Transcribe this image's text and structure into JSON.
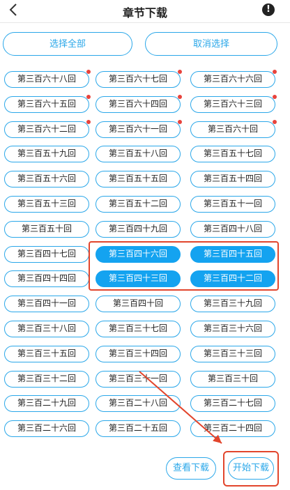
{
  "header": {
    "title": "章节下载",
    "info_symbol": "!"
  },
  "actions": {
    "select_all": "选择全部",
    "cancel_select": "取消选择"
  },
  "chapters": [
    {
      "label": "第三百六十八回",
      "dot": true,
      "selected": false
    },
    {
      "label": "第三百六十七回",
      "dot": true,
      "selected": false
    },
    {
      "label": "第三百六十六回",
      "dot": true,
      "selected": false
    },
    {
      "label": "第三百六十五回",
      "dot": true,
      "selected": false
    },
    {
      "label": "第三百六十四回",
      "dot": true,
      "selected": false
    },
    {
      "label": "第三百六十三回",
      "dot": true,
      "selected": false
    },
    {
      "label": "第三百六十二回",
      "dot": true,
      "selected": false
    },
    {
      "label": "第三百六十一回",
      "dot": true,
      "selected": false
    },
    {
      "label": "第三百六十回",
      "dot": true,
      "selected": false
    },
    {
      "label": "第三百五十九回",
      "dot": false,
      "selected": false
    },
    {
      "label": "第三百五十八回",
      "dot": false,
      "selected": false
    },
    {
      "label": "第三百五十七回",
      "dot": false,
      "selected": false
    },
    {
      "label": "第三百五十六回",
      "dot": false,
      "selected": false
    },
    {
      "label": "第三百五十五回",
      "dot": false,
      "selected": false
    },
    {
      "label": "第三百五十四回",
      "dot": false,
      "selected": false
    },
    {
      "label": "第三百五十三回",
      "dot": false,
      "selected": false
    },
    {
      "label": "第三百五十二回",
      "dot": false,
      "selected": false
    },
    {
      "label": "第三百五十一回",
      "dot": false,
      "selected": false
    },
    {
      "label": "第三百五十回",
      "dot": false,
      "selected": false
    },
    {
      "label": "第三百四十九回",
      "dot": false,
      "selected": false
    },
    {
      "label": "第三百四十八回",
      "dot": false,
      "selected": false
    },
    {
      "label": "第三百四十七回",
      "dot": false,
      "selected": false
    },
    {
      "label": "第三百四十六回",
      "dot": false,
      "selected": true
    },
    {
      "label": "第三百四十五回",
      "dot": false,
      "selected": true
    },
    {
      "label": "第三百四十四回",
      "dot": false,
      "selected": false
    },
    {
      "label": "第三百四十三回",
      "dot": false,
      "selected": true
    },
    {
      "label": "第三百四十二回",
      "dot": false,
      "selected": true
    },
    {
      "label": "第三百四十一回",
      "dot": false,
      "selected": false
    },
    {
      "label": "第三百四十回",
      "dot": false,
      "selected": false
    },
    {
      "label": "第三百三十九回",
      "dot": false,
      "selected": false
    },
    {
      "label": "第三百三十八回",
      "dot": false,
      "selected": false
    },
    {
      "label": "第三百三十七回",
      "dot": false,
      "selected": false
    },
    {
      "label": "第三百三十六回",
      "dot": false,
      "selected": false
    },
    {
      "label": "第三百三十五回",
      "dot": false,
      "selected": false
    },
    {
      "label": "第三百三十四回",
      "dot": false,
      "selected": false
    },
    {
      "label": "第三百三十三回",
      "dot": false,
      "selected": false
    },
    {
      "label": "第三百三十二回",
      "dot": false,
      "selected": false
    },
    {
      "label": "第三百三十一回",
      "dot": false,
      "selected": false
    },
    {
      "label": "第三百三十回",
      "dot": false,
      "selected": false
    },
    {
      "label": "第三百二十九回",
      "dot": false,
      "selected": false
    },
    {
      "label": "第三百二十八回",
      "dot": false,
      "selected": false
    },
    {
      "label": "第三百二十七回",
      "dot": false,
      "selected": false
    },
    {
      "label": "第三百二十六回",
      "dot": false,
      "selected": false
    },
    {
      "label": "第三百二十五回",
      "dot": false,
      "selected": false
    },
    {
      "label": "第三百二十四回",
      "dot": false,
      "selected": false
    }
  ],
  "bottom": {
    "view_downloads": "查看下载",
    "start_download": "开始下载"
  },
  "colors": {
    "accent": "#2aa7e9",
    "selected_fill": "#14a3f0",
    "new_dot": "#e8433c",
    "annotation": "#e2452c"
  }
}
